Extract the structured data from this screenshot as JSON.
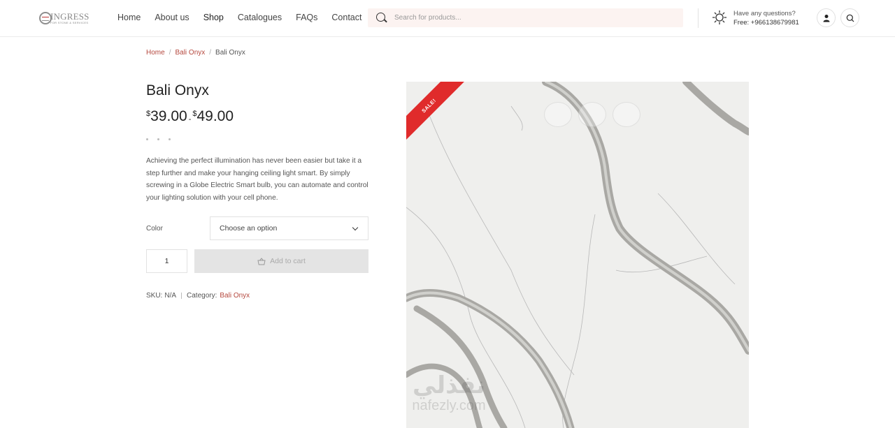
{
  "header": {
    "logo": {
      "name": "INGRESS",
      "tagline": "FOR STONE & SERVICES"
    },
    "nav": [
      "Home",
      "About us",
      "Shop",
      "Catalogues",
      "FAQs",
      "Contact"
    ],
    "search_placeholder": "Search for products...",
    "help": {
      "question": "Have any questions?",
      "phone": "Free: +966138679981"
    },
    "icons": [
      "sun-gear-icon",
      "user-icon",
      "search-icon"
    ]
  },
  "breadcrumb": {
    "home": "Home",
    "category": "Bali Onyx",
    "current": "Bali Onyx"
  },
  "product": {
    "title": "Bali Onyx",
    "price": {
      "currency": "$",
      "min": "39.00",
      "separator": "-",
      "max": "49.00"
    },
    "description": "Achieving the perfect illumination has never been easier but take it a step further and make your hanging ceiling light smart. By simply screwing in a Globe Electric Smart bulb, you can automate and control your lighting solution with your cell phone.",
    "color_label": "Color",
    "color_select": "Choose an option",
    "quantity": "1",
    "add_to_cart": "Add to cart",
    "sku_label": "SKU:",
    "sku_value": "N/A",
    "category_label": "Category:",
    "category_value": "Bali Onyx",
    "sale_badge": "SALE!"
  },
  "watermark": {
    "arabic": "نفذلي",
    "latin": "nafezly.com"
  },
  "colors": {
    "accent": "#b5483e",
    "sale": "#e02b2b",
    "search_bg": "#fcf3f1",
    "button_disabled": "#e4e4e4"
  }
}
